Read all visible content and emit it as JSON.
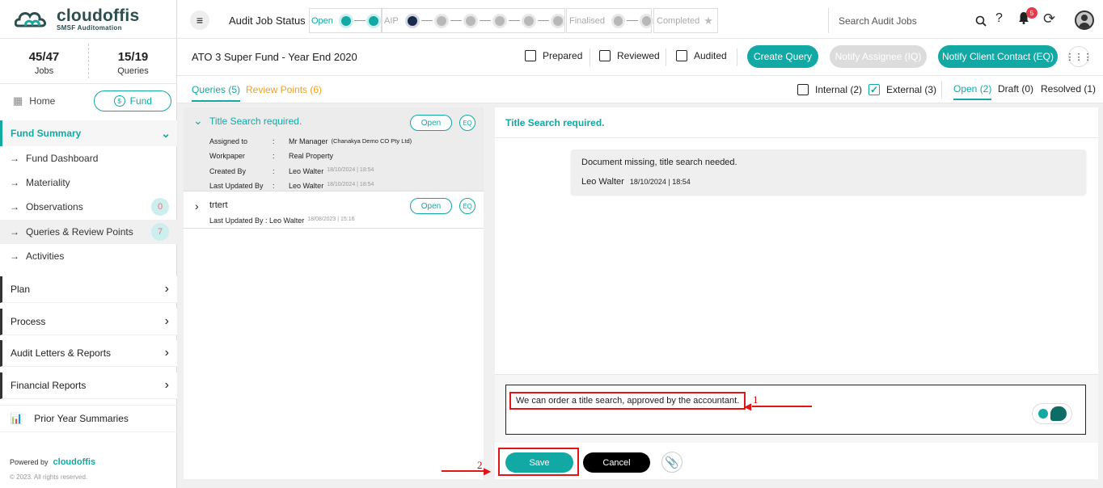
{
  "brand": {
    "name": "cloudoffis",
    "tagline": "SMSF Auditomation"
  },
  "stats": [
    {
      "value": "45/47",
      "label": "Jobs"
    },
    {
      "value": "15/19",
      "label": "Queries"
    }
  ],
  "nav": {
    "home": "Home",
    "fund": "Fund",
    "fund_summary": "Fund Summary",
    "items": [
      {
        "label": "Fund Dashboard"
      },
      {
        "label": "Materiality"
      },
      {
        "label": "Observations",
        "badge": "0"
      },
      {
        "label": "Queries & Review Points",
        "badge": "7"
      },
      {
        "label": "Activities"
      }
    ],
    "sections": [
      "Plan",
      "Process",
      "Audit Letters & Reports",
      "Financial Reports"
    ],
    "prior": "Prior Year Summaries",
    "powered_by": "Powered by",
    "powered_logo": "cloudoffis",
    "copyright": "© 2023. All rights reserved."
  },
  "header": {
    "title": "Audit Job Status",
    "stages": [
      "Open",
      "AIP",
      "Finalised",
      "Completed"
    ],
    "search_placeholder": "Search Audit Jobs",
    "notifications": "5"
  },
  "subheader": {
    "fund_title": "ATO 3 Super Fund - Year End 2020",
    "checks": [
      "Prepared",
      "Reviewed",
      "Audited"
    ],
    "buttons": {
      "create": "Create Query",
      "notify_assignee": "Notify Assignee (IQ)",
      "notify_client": "Notify Client Contact (EQ)"
    }
  },
  "tabs": {
    "queries": "Queries (5)",
    "review": "Review Points (6)",
    "internal": "Internal (2)",
    "external": "External (3)",
    "open": "Open (2)",
    "draft": "Draft (0)",
    "resolved": "Resolved (1)"
  },
  "queries": [
    {
      "title": "Title Search required.",
      "status": "Open",
      "type": "EQ",
      "assigned_label": "Assigned to",
      "assigned": "Mr Manager",
      "assigned_org": "(Chanakya Demo CO Pty Ltd)",
      "workpaper_label": "Workpaper",
      "workpaper": "Real Property",
      "created_label": "Created By",
      "created_by": "Leo Walter",
      "created_at": "18/10/2024 | 18:54",
      "updated_label": "Last Updated By",
      "updated_by": "Leo Walter",
      "updated_at": "18/10/2024 | 18:54"
    },
    {
      "title": "trtert",
      "status": "Open",
      "type": "EQ",
      "updated_line": "Last Updated By : Leo Walter",
      "updated_at": "18/08/2023 | 15:16"
    }
  ],
  "detail": {
    "title": "Title Search required.",
    "message": "Document missing, title search needed.",
    "author": "Leo Walter",
    "time": "18/10/2024 | 18:54",
    "reply": "We can order a title search, approved by the accountant.",
    "save": "Save",
    "cancel": "Cancel"
  },
  "annotations": [
    "1",
    "2"
  ],
  "colors": {
    "accent": "#12a9a4",
    "warning": "#f2a01b",
    "highlight": "#e01515"
  }
}
